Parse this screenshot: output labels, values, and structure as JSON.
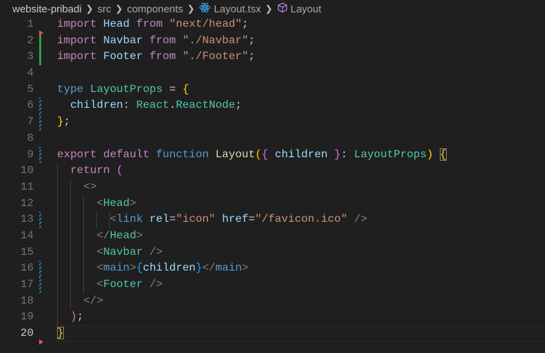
{
  "breadcrumb": {
    "items": [
      "website-pribadi",
      "src",
      "components",
      "Layout.tsx",
      "Layout"
    ],
    "icons": [
      "react-icon",
      "symbol-class-icon"
    ]
  },
  "editor": {
    "current_line": 20,
    "lines": [
      {
        "n": "1",
        "mark": "",
        "del": true,
        "t": [
          [
            "import ",
            "kw"
          ],
          [
            "Head ",
            "id"
          ],
          [
            "from ",
            "kw"
          ],
          [
            "\"next/head\"",
            "str"
          ],
          [
            ";",
            "pu"
          ]
        ]
      },
      {
        "n": "2",
        "mark": "add",
        "t": [
          [
            "import ",
            "kw"
          ],
          [
            "Navbar ",
            "id"
          ],
          [
            "from ",
            "kw"
          ],
          [
            "\"./Navbar\"",
            "str"
          ],
          [
            ";",
            "pu"
          ]
        ]
      },
      {
        "n": "3",
        "mark": "add",
        "t": [
          [
            "import ",
            "kw"
          ],
          [
            "Footer ",
            "id"
          ],
          [
            "from ",
            "kw"
          ],
          [
            "\"./Footer\"",
            "str"
          ],
          [
            ";",
            "pu"
          ]
        ]
      },
      {
        "n": "4",
        "mark": "",
        "t": []
      },
      {
        "n": "5",
        "mark": "",
        "t": [
          [
            "type ",
            "st"
          ],
          [
            "LayoutProps ",
            "ty"
          ],
          [
            "= ",
            "pu"
          ],
          [
            "{",
            "b1"
          ]
        ]
      },
      {
        "n": "6",
        "mark": "mod",
        "t": [
          [
            "  children",
            "id"
          ],
          [
            ": ",
            "pu"
          ],
          [
            "React",
            "ty"
          ],
          [
            ".",
            "pu"
          ],
          [
            "ReactNode",
            "ty"
          ],
          [
            ";",
            "pu"
          ]
        ]
      },
      {
        "n": "7",
        "mark": "mod",
        "t": [
          [
            "}",
            "b1"
          ],
          [
            ";",
            "pu"
          ]
        ]
      },
      {
        "n": "8",
        "mark": "",
        "t": []
      },
      {
        "n": "9",
        "mark": "mod",
        "t": [
          [
            "export ",
            "kw"
          ],
          [
            "default ",
            "kw"
          ],
          [
            "function ",
            "st"
          ],
          [
            "Layout",
            "fn"
          ],
          [
            "(",
            "b1"
          ],
          [
            "{ ",
            "b2"
          ],
          [
            "children ",
            "id"
          ],
          [
            "}",
            "b2"
          ],
          [
            ": ",
            "pu"
          ],
          [
            "LayoutProps",
            "ty"
          ],
          [
            ")",
            "b1"
          ],
          [
            " ",
            "pu"
          ],
          [
            "{",
            "b1 box"
          ]
        ]
      },
      {
        "n": "10",
        "mark": "",
        "t": [
          [
            "  ",
            "pu"
          ],
          [
            "return ",
            "kw"
          ],
          [
            "(",
            "b2"
          ]
        ]
      },
      {
        "n": "11",
        "mark": "",
        "t": [
          [
            "    ",
            "pu"
          ],
          [
            "<>",
            "tg"
          ]
        ]
      },
      {
        "n": "12",
        "mark": "",
        "t": [
          [
            "      ",
            "pu"
          ],
          [
            "<",
            "tg"
          ],
          [
            "Head",
            "ty"
          ],
          [
            ">",
            "tg"
          ]
        ]
      },
      {
        "n": "13",
        "mark": "mod",
        "t": [
          [
            "        ",
            "pu"
          ],
          [
            "<",
            "tg"
          ],
          [
            "link ",
            "st"
          ],
          [
            "rel",
            "id"
          ],
          [
            "=",
            "pu"
          ],
          [
            "\"icon\" ",
            "str"
          ],
          [
            "href",
            "id"
          ],
          [
            "=",
            "pu"
          ],
          [
            "\"/favicon.ico\" ",
            "str"
          ],
          [
            "/>",
            "tg"
          ]
        ]
      },
      {
        "n": "14",
        "mark": "",
        "t": [
          [
            "      ",
            "pu"
          ],
          [
            "</",
            "tg"
          ],
          [
            "Head",
            "ty"
          ],
          [
            ">",
            "tg"
          ]
        ]
      },
      {
        "n": "15",
        "mark": "",
        "t": [
          [
            "      ",
            "pu"
          ],
          [
            "<",
            "tg"
          ],
          [
            "Navbar ",
            "ty"
          ],
          [
            "/>",
            "tg"
          ]
        ]
      },
      {
        "n": "16",
        "mark": "mod",
        "t": [
          [
            "      ",
            "pu"
          ],
          [
            "<",
            "tg"
          ],
          [
            "main",
            "st"
          ],
          [
            ">",
            "tg"
          ],
          [
            "{",
            "b3"
          ],
          [
            "children",
            "id"
          ],
          [
            "}",
            "b3"
          ],
          [
            "</",
            "tg"
          ],
          [
            "main",
            "st"
          ],
          [
            ">",
            "tg"
          ]
        ]
      },
      {
        "n": "17",
        "mark": "mod",
        "t": [
          [
            "      ",
            "pu"
          ],
          [
            "<",
            "tg"
          ],
          [
            "Footer ",
            "ty"
          ],
          [
            "/>",
            "tg"
          ]
        ]
      },
      {
        "n": "18",
        "mark": "",
        "t": [
          [
            "    ",
            "pu"
          ],
          [
            "</>",
            "tg"
          ]
        ]
      },
      {
        "n": "19",
        "mark": "",
        "t": [
          [
            "  ",
            "pu"
          ],
          [
            ")",
            "b2"
          ],
          [
            ";",
            "pu"
          ]
        ]
      },
      {
        "n": "20",
        "mark": "",
        "del": true,
        "t": [
          [
            "}",
            "b1 box"
          ]
        ]
      }
    ]
  }
}
